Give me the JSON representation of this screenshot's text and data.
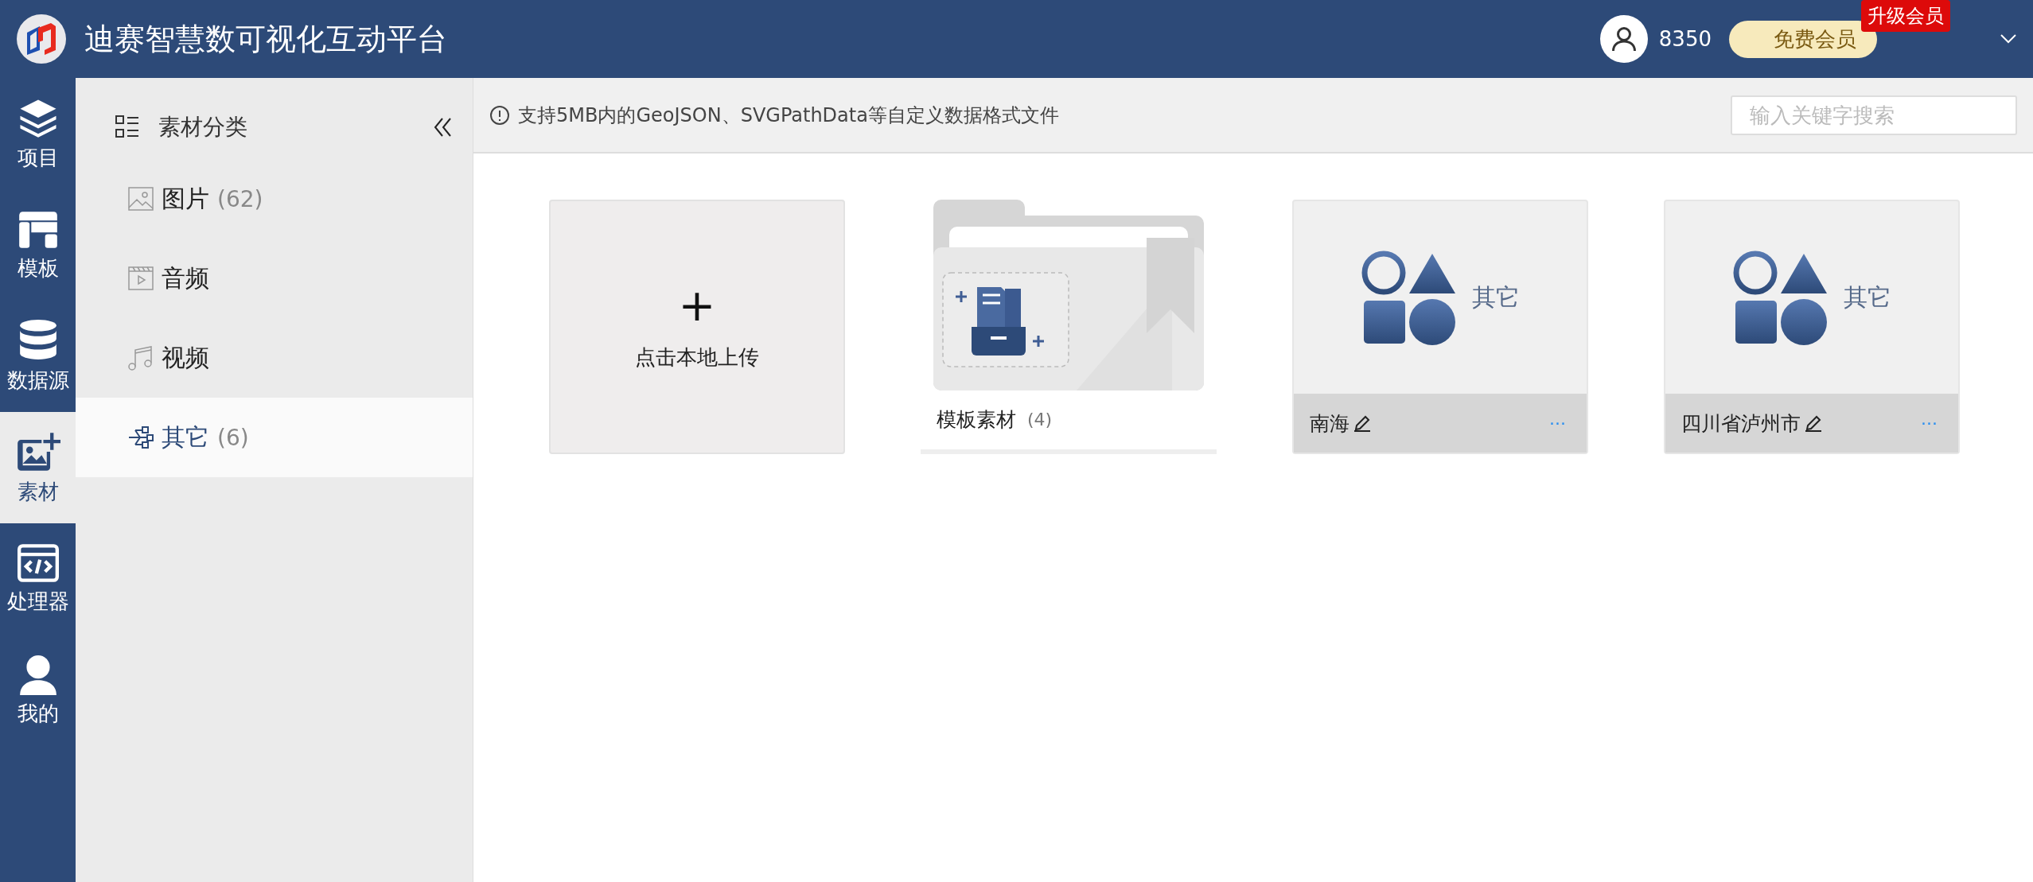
{
  "header": {
    "title": "迪赛智慧数可视化互动平台",
    "points": "8350",
    "membership": "免费会员",
    "upgrade_badge": "升级会员"
  },
  "nav": [
    {
      "label": "项目",
      "selected": false
    },
    {
      "label": "模板",
      "selected": false
    },
    {
      "label": "数据源",
      "selected": false
    },
    {
      "label": "素材",
      "selected": true
    },
    {
      "label": "处理器",
      "selected": false
    },
    {
      "label": "我的",
      "selected": false
    }
  ],
  "category_panel": {
    "title": "素材分类",
    "items": [
      {
        "label": "图片",
        "count": "(62)",
        "selected": false
      },
      {
        "label": "音频",
        "selected": false
      },
      {
        "label": "视频",
        "selected": false
      },
      {
        "label": "其它",
        "count": "(6)",
        "selected": true
      }
    ]
  },
  "notice": "支持5MB内的GeoJSON、SVGPathData等自定义数据格式文件",
  "search": {
    "placeholder": "输入关键字搜索"
  },
  "upload_card": {
    "symbol": "+",
    "label": "点击本地上传"
  },
  "folder": {
    "label": "模板素材",
    "count": "(4)"
  },
  "files": [
    {
      "name": "南海",
      "thumbnail_label": "其它",
      "more": "···"
    },
    {
      "name": "四川省泸州市",
      "thumbnail_label": "其它",
      "more": "···"
    }
  ]
}
